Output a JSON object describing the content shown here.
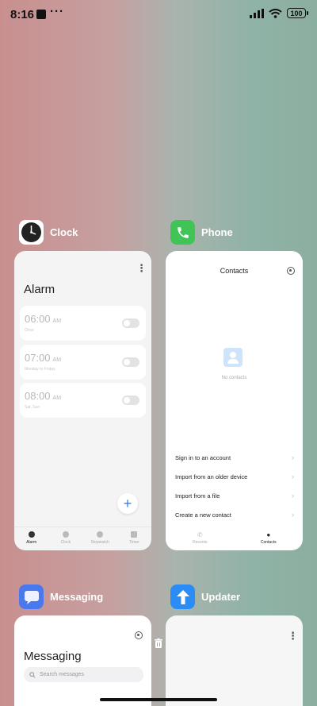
{
  "status": {
    "time": "8:16",
    "dots": "···",
    "battery": "100"
  },
  "clock": {
    "app_name": "Clock",
    "title": "Alarm",
    "alarms": [
      {
        "time": "06:00",
        "ampm": "AM",
        "sub": "Once"
      },
      {
        "time": "07:00",
        "ampm": "AM",
        "sub": "Monday to Friday"
      },
      {
        "time": "08:00",
        "ampm": "AM",
        "sub": "Sat, Sun"
      }
    ],
    "fab": "+",
    "tabs": [
      "Alarm",
      "Clock",
      "Stopwatch",
      "Timer"
    ]
  },
  "phone": {
    "app_name": "Phone",
    "title": "Contacts",
    "empty_text": "No contacts",
    "rows": [
      "Sign in to an account",
      "Import from an older device",
      "Import from a file",
      "Create a new contact"
    ],
    "tabs": [
      "Recents",
      "Contacts"
    ]
  },
  "messaging": {
    "app_name": "Messaging",
    "title": "Messaging",
    "search_placeholder": "Search messages"
  },
  "updater": {
    "app_name": "Updater"
  },
  "colors": {
    "accent": "#2f7ef5",
    "phone_green": "#3fc455",
    "updater_blue": "#2c8cf5",
    "messaging_blue": "#4a78ee"
  }
}
